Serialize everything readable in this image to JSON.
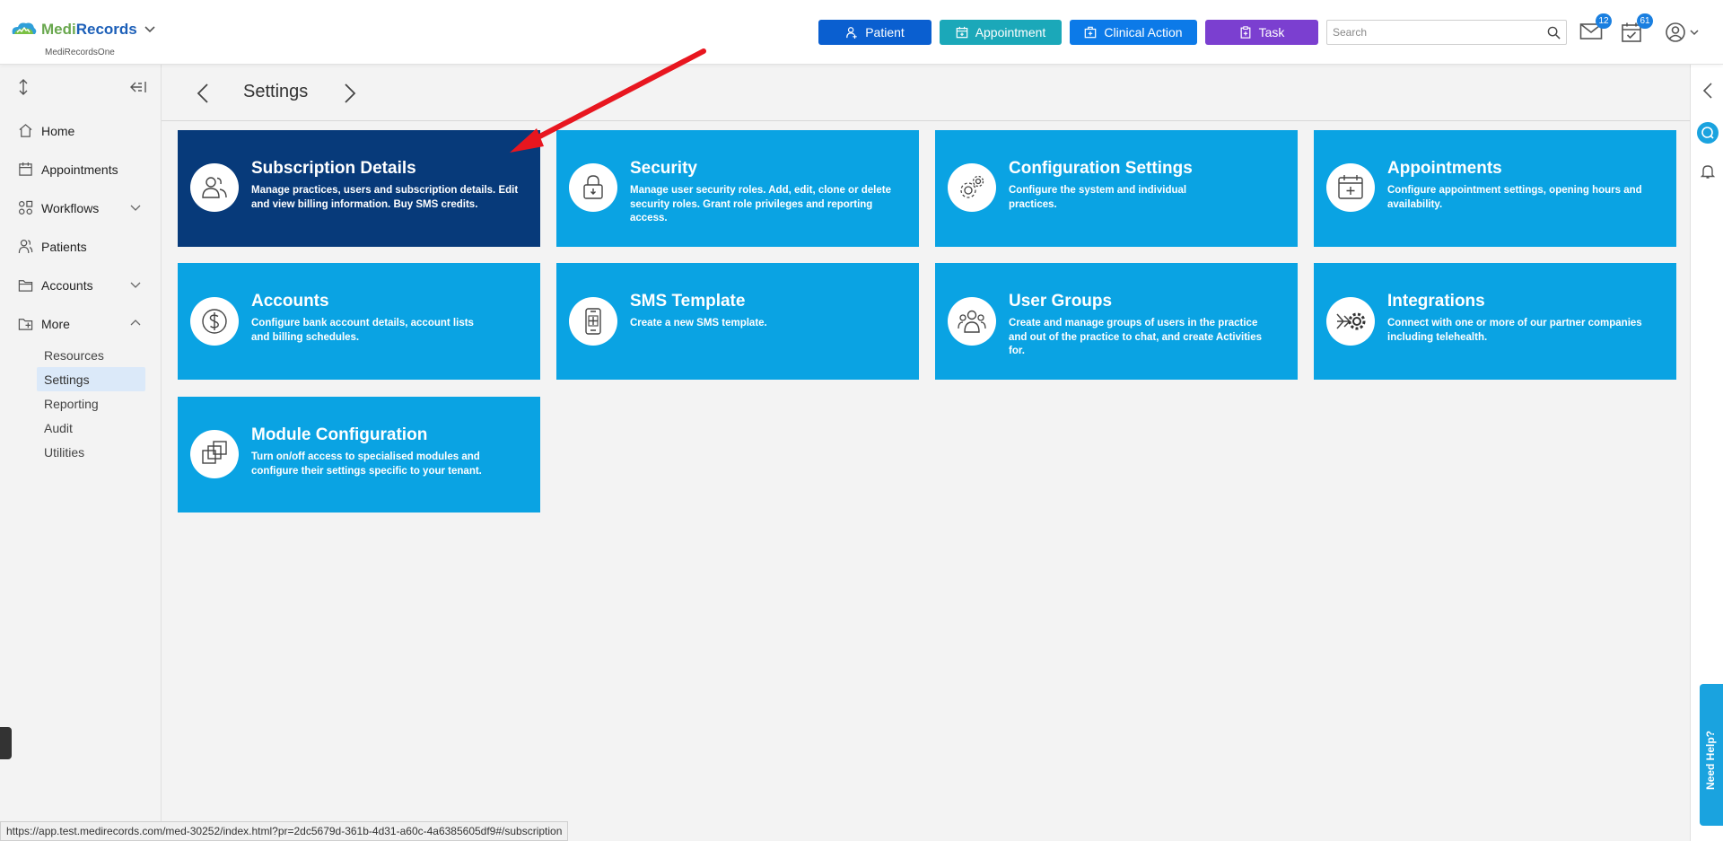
{
  "brand": {
    "name_part1": "Medi",
    "name_part2": "Records",
    "subtitle": "MediRecordsOne"
  },
  "quick_actions": [
    {
      "label": "Patient",
      "color": "#0a5fd0"
    },
    {
      "label": "Appointment",
      "color": "#1ba8b9"
    },
    {
      "label": "Clinical Action",
      "color": "#0c7ae8"
    },
    {
      "label": "Task",
      "color": "#7b3fd0"
    }
  ],
  "search": {
    "placeholder": "Search"
  },
  "badges": {
    "messages": "12",
    "tasks": "61"
  },
  "sidebar": {
    "items": [
      {
        "label": "Home",
        "icon": "home-icon"
      },
      {
        "label": "Appointments",
        "icon": "calendar-icon"
      },
      {
        "label": "Workflows",
        "icon": "workflow-icon"
      },
      {
        "label": "Patients",
        "icon": "patients-icon"
      },
      {
        "label": "Accounts",
        "icon": "folder-icon"
      },
      {
        "label": "More",
        "icon": "more-icon"
      }
    ],
    "sub_items": [
      "Resources",
      "Settings",
      "Reporting",
      "Audit",
      "Utilities"
    ]
  },
  "page": {
    "title": "Settings"
  },
  "tiles": [
    {
      "title": "Subscription Details",
      "desc": "Manage practices, users and subscription details. Edit and view billing information. Buy SMS credits.",
      "icon": "users-icon"
    },
    {
      "title": "Security",
      "desc": "Manage user security roles. Add, edit, clone or delete security roles. Grant role privileges and reporting access.",
      "icon": "lock-icon"
    },
    {
      "title": "Configuration Settings",
      "desc": "Configure the system and individual practices.",
      "icon": "gears-icon"
    },
    {
      "title": "Appointments",
      "desc": "Configure appointment settings, opening hours and availability.",
      "icon": "calendar-plus-icon"
    },
    {
      "title": "Accounts",
      "desc": "Configure bank account details, account lists and billing schedules.",
      "icon": "dollar-icon"
    },
    {
      "title": "SMS Template",
      "desc": "Create a new SMS template.",
      "icon": "phone-plus-icon"
    },
    {
      "title": "User Groups",
      "desc": "Create and manage groups of users in the practice and out of the practice to chat, and create Activities for.",
      "icon": "group-icon"
    },
    {
      "title": "Integrations",
      "desc": "Connect with one or more of our partner companies including telehealth.",
      "icon": "integration-icon"
    },
    {
      "title": "Module Configuration",
      "desc": "Turn on/off access to specialised modules and configure their settings specific to your tenant.",
      "icon": "modules-icon"
    }
  ],
  "need_help": "Need Help?",
  "status_url": "https://app.test.medirecords.com/med-30252/index.html?pr=2dc5679d-361b-4d31-a60c-4a6385605df9#/subscription"
}
